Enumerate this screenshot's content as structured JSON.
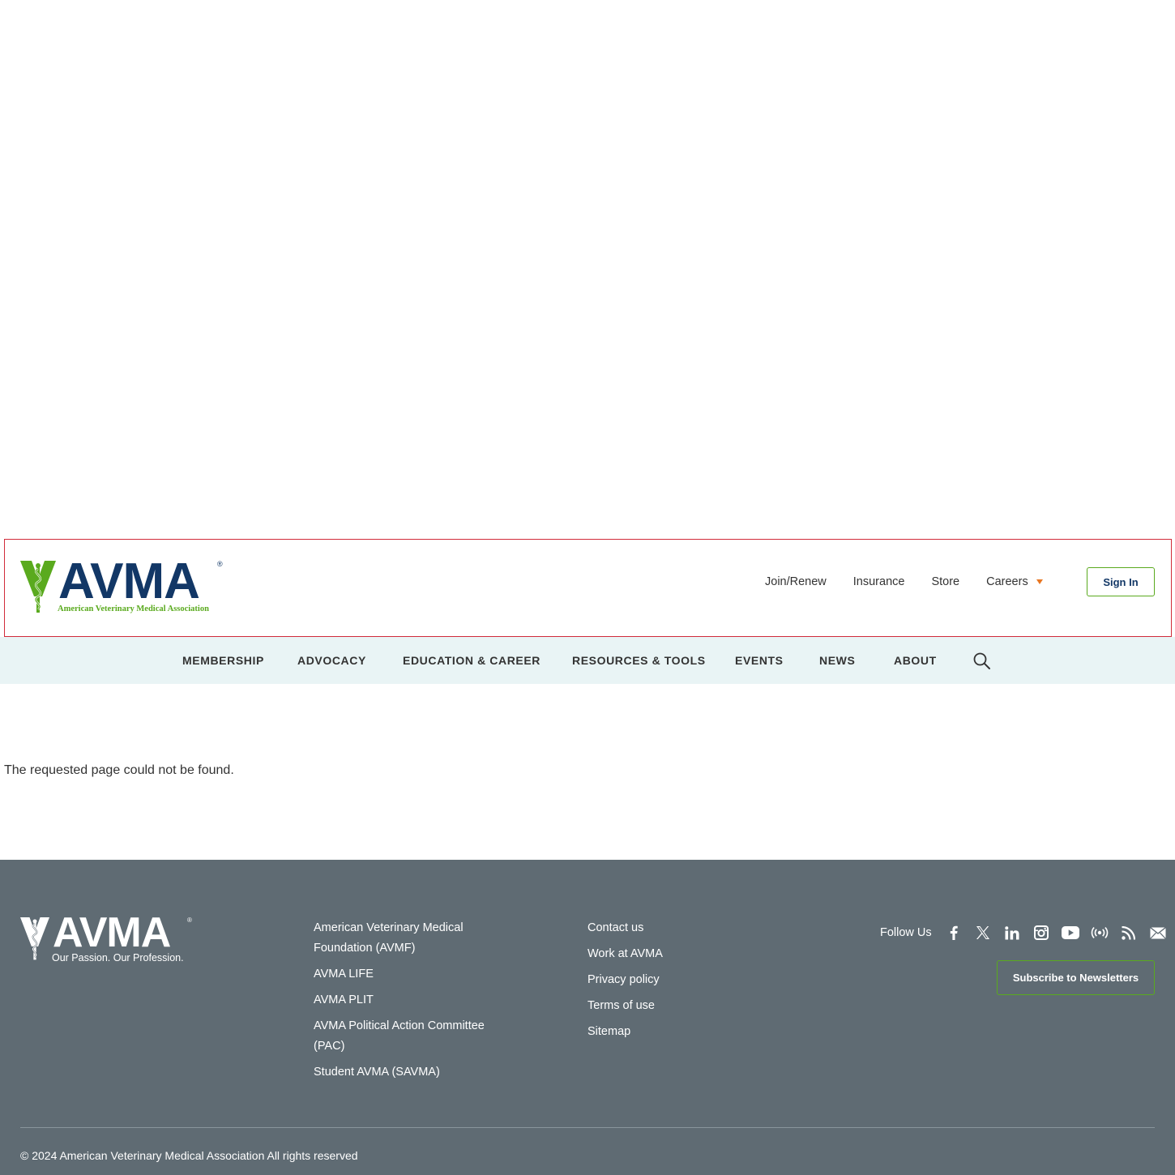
{
  "header": {
    "logo_wordmark": "AVMA",
    "logo_registered": "®",
    "logo_subtitle": "American Veterinary Medical Association",
    "utility_links": [
      "Join/Renew",
      "Insurance",
      "Store",
      "Careers"
    ],
    "sign_in_label": "Sign In"
  },
  "nav": {
    "items": [
      "MEMBERSHIP",
      "ADVOCACY",
      "EDUCATION & CAREER",
      "RESOURCES & TOOLS",
      "EVENTS",
      "NEWS",
      "ABOUT"
    ],
    "search_icon": "search-icon"
  },
  "content": {
    "message": "The requested page could not be found."
  },
  "footer": {
    "logo_wordmark": "AVMA",
    "logo_registered": "®",
    "logo_tagline": "Our Passion. Our Profession.",
    "column1": [
      "American Veterinary Medical Foundation (AVMF)",
      "AVMA LIFE",
      "AVMA PLIT",
      "AVMA Political Action Committee (PAC)",
      "Student AVMA (SAVMA)"
    ],
    "column2": [
      "Contact us",
      "Work at AVMA",
      "Privacy policy",
      "Terms of use",
      "Sitemap"
    ],
    "follow_label": "Follow Us",
    "social_icons": [
      "facebook-icon",
      "x-icon",
      "linkedin-icon",
      "instagram-icon",
      "youtube-icon",
      "podcast-icon",
      "rss-icon",
      "email-icon"
    ],
    "subscribe_label": "Subscribe to Newsletters",
    "copyright": "© 2024 American Veterinary Medical Association All rights reserved"
  },
  "colors": {
    "navy": "#123766",
    "green": "#5aaa1e",
    "orange": "#e87722",
    "nav_bg": "#e9f4f5",
    "footer_bg": "#5f6b73",
    "header_border": "#d12b3a"
  }
}
